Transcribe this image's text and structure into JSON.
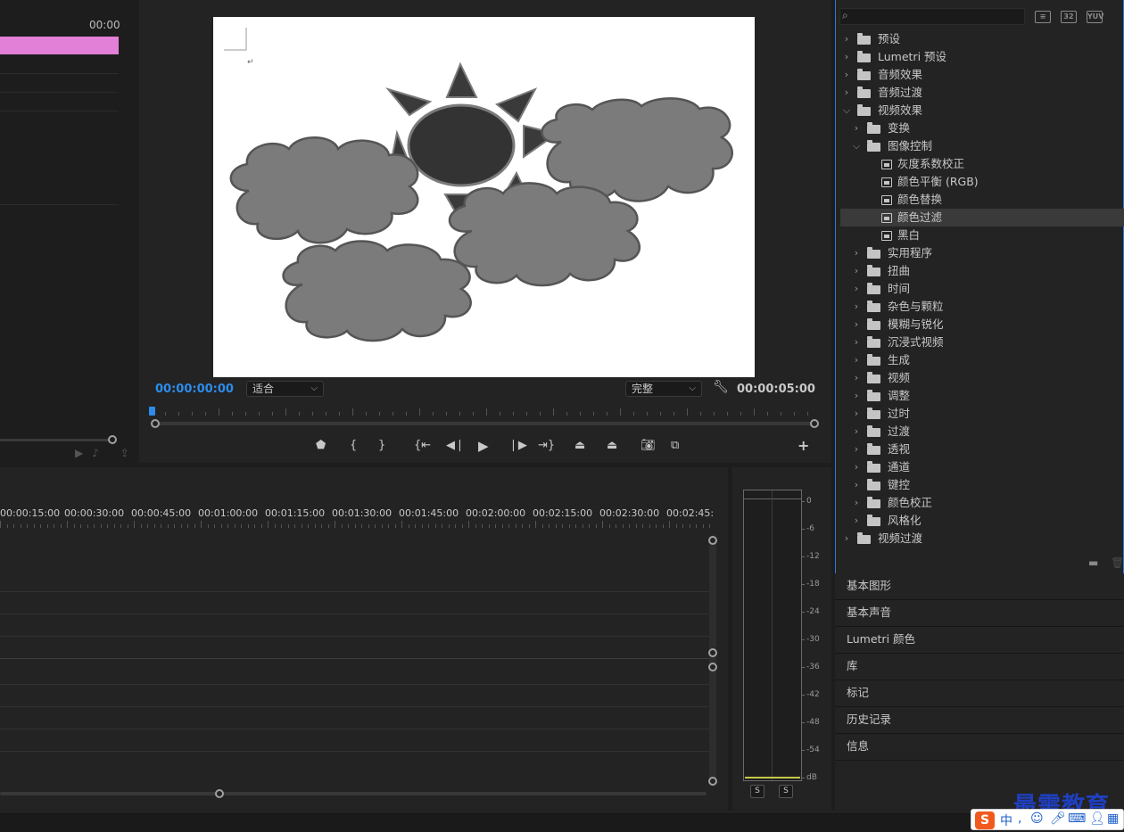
{
  "source_monitor": {
    "timecode": "00:00"
  },
  "program_monitor": {
    "current_timecode": "00:00:00:00",
    "zoom_select": "适合",
    "quality_select": "完整",
    "duration_timecode": "00:00:05:00",
    "transport_icons": [
      "marker-icon",
      "mark-in-icon",
      "mark-out-icon",
      "go-to-in-icon",
      "step-back-icon",
      "play-icon",
      "step-forward-icon",
      "go-to-out-icon",
      "lift-icon",
      "extract-icon",
      "export-frame-icon",
      "comparison-view-icon",
      "add-button-icon"
    ]
  },
  "effects": {
    "search_value": "",
    "toolbar_badges": [
      "32",
      "YUV"
    ],
    "tree": [
      {
        "label": "预设",
        "level": 0,
        "expanded": false,
        "kind": "folder-star"
      },
      {
        "label": "Lumetri 预设",
        "level": 0,
        "expanded": false,
        "kind": "folder-star"
      },
      {
        "label": "音频效果",
        "level": 0,
        "expanded": false,
        "kind": "folder"
      },
      {
        "label": "音频过渡",
        "level": 0,
        "expanded": false,
        "kind": "folder"
      },
      {
        "label": "视频效果",
        "level": 0,
        "expanded": true,
        "kind": "folder"
      },
      {
        "label": "变换",
        "level": 1,
        "expanded": false,
        "kind": "folder"
      },
      {
        "label": "图像控制",
        "level": 1,
        "expanded": true,
        "kind": "folder"
      },
      {
        "label": "灰度系数校正",
        "level": 2,
        "kind": "effect"
      },
      {
        "label": "颜色平衡 (RGB)",
        "level": 2,
        "kind": "effect"
      },
      {
        "label": "颜色替换",
        "level": 2,
        "kind": "effect"
      },
      {
        "label": "颜色过滤",
        "level": 2,
        "kind": "effect",
        "selected": true
      },
      {
        "label": "黑白",
        "level": 2,
        "kind": "effect"
      },
      {
        "label": "实用程序",
        "level": 1,
        "expanded": false,
        "kind": "folder"
      },
      {
        "label": "扭曲",
        "level": 1,
        "expanded": false,
        "kind": "folder"
      },
      {
        "label": "时间",
        "level": 1,
        "expanded": false,
        "kind": "folder"
      },
      {
        "label": "杂色与颗粒",
        "level": 1,
        "expanded": false,
        "kind": "folder"
      },
      {
        "label": "模糊与锐化",
        "level": 1,
        "expanded": false,
        "kind": "folder"
      },
      {
        "label": "沉浸式视频",
        "level": 1,
        "expanded": false,
        "kind": "folder"
      },
      {
        "label": "生成",
        "level": 1,
        "expanded": false,
        "kind": "folder"
      },
      {
        "label": "视频",
        "level": 1,
        "expanded": false,
        "kind": "folder"
      },
      {
        "label": "调整",
        "level": 1,
        "expanded": false,
        "kind": "folder"
      },
      {
        "label": "过时",
        "level": 1,
        "expanded": false,
        "kind": "folder"
      },
      {
        "label": "过渡",
        "level": 1,
        "expanded": false,
        "kind": "folder"
      },
      {
        "label": "透视",
        "level": 1,
        "expanded": false,
        "kind": "folder"
      },
      {
        "label": "通道",
        "level": 1,
        "expanded": false,
        "kind": "folder"
      },
      {
        "label": "键控",
        "level": 1,
        "expanded": false,
        "kind": "folder"
      },
      {
        "label": "颜色校正",
        "level": 1,
        "expanded": false,
        "kind": "folder"
      },
      {
        "label": "风格化",
        "level": 1,
        "expanded": false,
        "kind": "folder"
      },
      {
        "label": "视频过渡",
        "level": 0,
        "expanded": false,
        "kind": "folder"
      }
    ]
  },
  "side_panels": [
    "基本图形",
    "基本声音",
    "Lumetri 颜色",
    "库",
    "标记",
    "历史记录",
    "信息"
  ],
  "timeline": {
    "ruler_labels": [
      "00:00:15:00",
      "00:00:30:00",
      "00:00:45:00",
      "00:01:00:00",
      "00:01:15:00",
      "00:01:30:00",
      "00:01:45:00",
      "00:02:00:00",
      "00:02:15:00",
      "00:02:30:00",
      "00:02:45:"
    ]
  },
  "audio_meter": {
    "db_labels": [
      "0",
      "-6",
      "-12",
      "-18",
      "-24",
      "-30",
      "-36",
      "-42",
      "-48",
      "-54",
      "dB"
    ],
    "solo_labels": [
      "S",
      "S"
    ]
  },
  "watermark": {
    "text": "最需教育",
    "ime_label": "中"
  },
  "colors": {
    "accent_blue": "#2d8ceb",
    "clip_pink": "#e27fd6",
    "panel_focus_border": "#2d7ad6"
  }
}
